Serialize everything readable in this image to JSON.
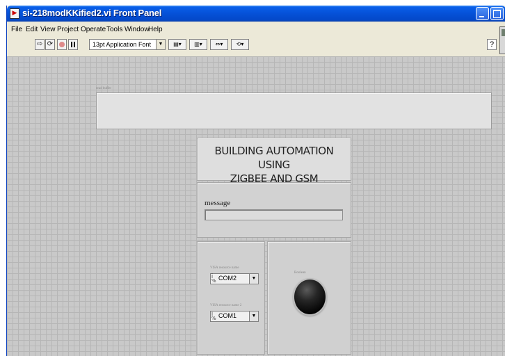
{
  "window": {
    "title": "si-218modKKified2.vi Front Panel",
    "icon": "labview-vi-icon"
  },
  "menu": [
    "File",
    "Edit",
    "View",
    "Project",
    "Operate",
    "Tools",
    "Window",
    "Help"
  ],
  "toolbar": {
    "font": "13pt Application Font",
    "help": "?"
  },
  "panel": {
    "buffer_label": "read buffer",
    "title_line1": "BUILDING AUTOMATION USING",
    "title_line2": "ZIGBEE AND GSM",
    "message_label": "message",
    "visa1_label": "VISA resource name",
    "visa1_value": "COM2",
    "visa2_label": "VISA resource name 2",
    "visa2_value": "COM1",
    "led_label": "Boolean"
  }
}
